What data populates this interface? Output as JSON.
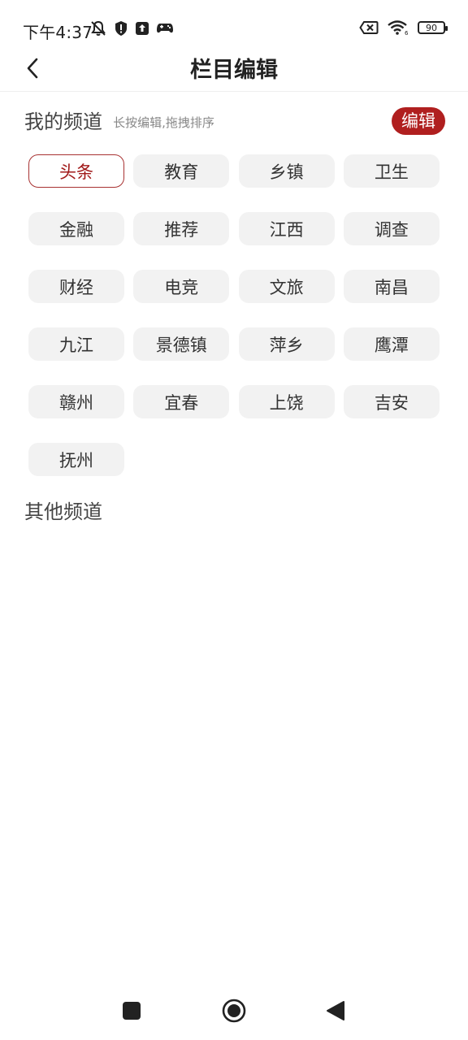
{
  "status_bar": {
    "time": "下午4:37",
    "battery": "90",
    "left_icons": [
      "mute-bell-icon",
      "shield-icon",
      "upload-icon",
      "gamepad-icon"
    ],
    "right_icons": [
      "no-sim-icon",
      "wifi-icon",
      "battery-icon"
    ]
  },
  "header": {
    "title": "栏目编辑",
    "back_icon": "chevron-left-icon"
  },
  "my_channels": {
    "title": "我的频道",
    "hint": "长按编辑,拖拽排序",
    "edit_label": "编辑",
    "items": [
      {
        "label": "头条",
        "active": true
      },
      {
        "label": "教育"
      },
      {
        "label": "乡镇"
      },
      {
        "label": "卫生"
      },
      {
        "label": "金融"
      },
      {
        "label": "推荐"
      },
      {
        "label": "江西"
      },
      {
        "label": "调查"
      },
      {
        "label": "财经"
      },
      {
        "label": "电竞"
      },
      {
        "label": "文旅"
      },
      {
        "label": "南昌"
      },
      {
        "label": "九江"
      },
      {
        "label": "景德镇"
      },
      {
        "label": "萍乡"
      },
      {
        "label": "鹰潭"
      },
      {
        "label": "赣州"
      },
      {
        "label": "宜春"
      },
      {
        "label": "上饶"
      },
      {
        "label": "吉安"
      },
      {
        "label": "抚州"
      }
    ]
  },
  "other_channels": {
    "title": "其他频道"
  },
  "colors": {
    "accent": "#b01f1f",
    "chip_bg": "#f2f2f2",
    "active_text": "#a01818"
  },
  "nav_bar": {
    "icons": [
      "recent-apps-icon",
      "home-icon",
      "back-triangle-icon"
    ]
  }
}
